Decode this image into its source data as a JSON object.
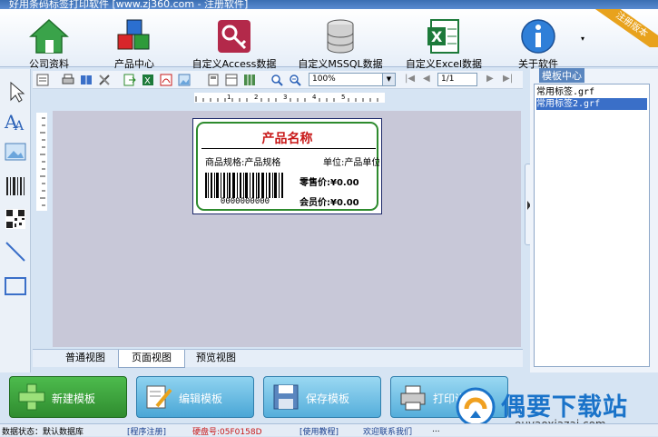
{
  "window": {
    "title": "好用条码标签打印软件 [www.zj360.com - 注册软件]"
  },
  "main_toolbar": [
    {
      "name": "company",
      "label": "公司资料"
    },
    {
      "name": "products",
      "label": "产品中心"
    },
    {
      "name": "access",
      "label": "自定义Access数据"
    },
    {
      "name": "mssql",
      "label": "自定义MSSQL数据"
    },
    {
      "name": "excel",
      "label": "自定义Excel数据"
    },
    {
      "name": "about",
      "label": "关于软件"
    }
  ],
  "ribbon_text": "注册版本",
  "editor_toolbar": {
    "zoom": "100%",
    "page": "1/1"
  },
  "label": {
    "product_name": "产品名称",
    "spec": "商品规格:产品规格",
    "unit": "单位:产品单位",
    "barcode_number": "0000000000",
    "retail_price": "零售价:¥0.00",
    "member_price": "会员价:¥0.00"
  },
  "ruler": {
    "h": "1 . 2 . 3 . 4 . 5"
  },
  "view_tabs": [
    "普通视图",
    "页面视图",
    "预览视图"
  ],
  "template_center": {
    "title": "模板中心",
    "items": [
      "常用标签.grf",
      "常用标签2.grf"
    ],
    "selected": 1
  },
  "bottom_buttons": [
    "新建模板",
    "编辑模板",
    "保存模板",
    "打印设置"
  ],
  "status_bar": {
    "db_status": "数据状态：默认数据库",
    "register": "[程序注册]",
    "hardware": "硬盘号:05F0158D",
    "tutorial": "[使用教程]",
    "contact": "欢迎联系我们",
    "more": "..."
  },
  "watermark": {
    "title": "偶要下载站",
    "url": "ouyaoxiazai.com"
  },
  "colors": {
    "accent": "#1a73c9",
    "label_border": "#2e8b2e",
    "product_name": "#c81818",
    "canvas": "#c8c8d8"
  }
}
